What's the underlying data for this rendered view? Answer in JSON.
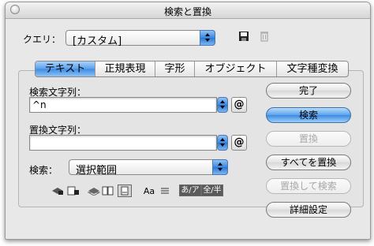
{
  "window": {
    "title": "検索と置換"
  },
  "query": {
    "label": "クエリ：",
    "value": "[カスタム]"
  },
  "tabs": [
    {
      "label": "テキスト",
      "selected": true
    },
    {
      "label": "正規表現",
      "selected": false
    },
    {
      "label": "字形",
      "selected": false
    },
    {
      "label": "オブジェクト",
      "selected": false
    },
    {
      "label": "文字種変換",
      "selected": false
    }
  ],
  "find": {
    "label": "検索文字列：",
    "value": "^n",
    "special_char_button": "@"
  },
  "change": {
    "label": "置換文字列：",
    "value": "",
    "special_char_button": "@"
  },
  "search": {
    "label": "検索：",
    "value": "選択範囲"
  },
  "option_icons": [
    "include-locked-layers-icon",
    "include-locked-stories-icon",
    "include-hidden-layers-icon",
    "include-master-pages-icon",
    "include-footnotes-icon"
  ],
  "case_sensitive_label": "Aa",
  "whole_word_icon": "whole-word-icon",
  "kana_toggle_label": "あ/ア",
  "width_toggle_label": "全/半",
  "buttons": {
    "done": "完了",
    "find": "検索",
    "change": "置換",
    "change_all": "すべてを置換",
    "change_find": "置換して検索",
    "fewer_options": "詳細設定"
  },
  "colors": {
    "accent": "#3d8be3",
    "disabled_text": "#a8a8a8"
  }
}
